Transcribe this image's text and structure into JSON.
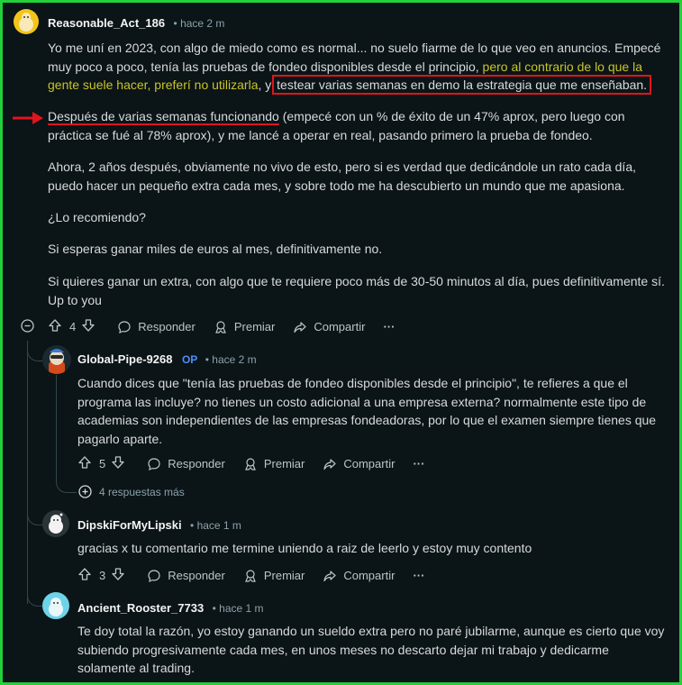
{
  "main_comment": {
    "author": "Reasonable_Act_186",
    "meta": "• hace 2 m",
    "p1_a": "Yo me uní en 2023, con algo de miedo como es normal... no suelo fiarme de lo que veo en anuncios. Empecé muy poco a poco, tenía las pruebas de fondeo disponibles desde el principio, ",
    "p1_highlight": "pero al contrario de lo que la gente suele hacer, preferí no utilizarla",
    "p1_mid": ", y ",
    "p1_boxed": "testear varias semanas en demo la estrategia que me enseñaban.",
    "p2_underlined": "Después de varias semanas funcionando",
    "p2_rest": " (empecé con un % de éxito de un 47% aprox, pero luego con práctica se fué al 78% aprox), y me lancé a operar en real, pasando primero la prueba de fondeo.",
    "p3": "Ahora, 2 años después, obviamente no vivo de esto, pero si es verdad que dedicándole un rato cada día, puedo hacer un pequeño extra cada mes, y sobre todo me ha descubierto un mundo que me apasiona.",
    "p4": "¿Lo recomiendo?",
    "p5": "Si esperas ganar miles de euros al mes, definitivamente no.",
    "p6": "Si quieres ganar un extra, con algo que te requiere poco más de 30-50 minutos al día, pues definitivamente sí. Up to you",
    "votes": "4",
    "reply": "Responder",
    "award": "Premiar",
    "share": "Compartir",
    "more": "···"
  },
  "reply1": {
    "author": "Global-Pipe-9268",
    "op_badge": "OP",
    "meta": "• hace 2 m",
    "text": "Cuando dices que \"tenía las pruebas de fondeo disponibles desde el principio\", te refieres a que el programa las incluye? no tienes un costo adicional a una empresa externa? normalmente este tipo de academias son independientes de las empresas fondeadoras, por lo que el examen siempre tienes que pagarlo aparte.",
    "votes": "5",
    "reply": "Responder",
    "award": "Premiar",
    "share": "Compartir",
    "more": "···",
    "more_replies": "4 respuestas más"
  },
  "reply2": {
    "author": "DipskiForMyLipski",
    "meta": "• hace 1 m",
    "text": "gracias x tu comentario me termine uniendo a raiz de leerlo y estoy muy contento",
    "votes": "3",
    "reply": "Responder",
    "award": "Premiar",
    "share": "Compartir",
    "more": "···"
  },
  "reply3": {
    "author": "Ancient_Rooster_7733",
    "meta": "• hace 1 m",
    "text": "Te doy total la razón, yo estoy ganando un sueldo extra pero no paré jubilarme, aunque es cierto que voy subiendo progresivamente cada mes, en unos meses no descarto dejar mi trabajo y dedicarme solamente al trading."
  },
  "colors": {
    "frame": "#22d13a",
    "annotation_red": "#e0141e",
    "highlight_yellow": "#c8c42b",
    "background": "#0b1416"
  },
  "icons": [
    "upvote-icon",
    "downvote-icon",
    "comment-icon",
    "award-icon",
    "share-icon",
    "collapse-icon",
    "expand-icon",
    "red-arrow-icon"
  ]
}
